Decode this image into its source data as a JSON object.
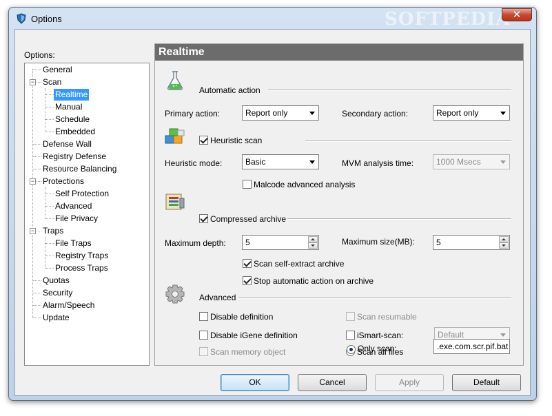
{
  "window": {
    "title": "Options",
    "watermark": "SOFTPEDIA",
    "close_glyph": "✕"
  },
  "tree": {
    "label": "Options:",
    "items": [
      {
        "label": "General"
      },
      {
        "label": "Scan",
        "expander": "−"
      },
      {
        "label": "Realtime",
        "selected": true
      },
      {
        "label": "Manual"
      },
      {
        "label": "Schedule"
      },
      {
        "label": "Embedded"
      },
      {
        "label": "Defense Wall"
      },
      {
        "label": "Registry Defense"
      },
      {
        "label": "Resource Balancing"
      },
      {
        "label": "Protections",
        "expander": "−"
      },
      {
        "label": "Self Protection"
      },
      {
        "label": "Advanced"
      },
      {
        "label": "File Privacy"
      },
      {
        "label": "Traps",
        "expander": "−"
      },
      {
        "label": "File Traps"
      },
      {
        "label": "Registry Traps"
      },
      {
        "label": "Process Traps"
      },
      {
        "label": "Quotas"
      },
      {
        "label": "Security"
      },
      {
        "label": "Alarm/Speech"
      },
      {
        "label": "Update"
      }
    ]
  },
  "panel": {
    "title": "Realtime",
    "automatic_action": {
      "section_label": "Automatic action",
      "icon": "flask-icon",
      "primary_label": "Primary action:",
      "primary_value": "Report only",
      "secondary_label": "Secondary action:",
      "secondary_value": "Report only"
    },
    "heuristic": {
      "icon": "blocks-icon",
      "checkbox_label": "Heuristic scan",
      "checked": true,
      "mode_label": "Heuristic mode:",
      "mode_value": "Basic",
      "mvm_label": "MVM analysis time:",
      "mvm_value": "1000 Msecs",
      "malcode_label": "Malcode advanced analysis",
      "malcode_checked": false
    },
    "compressed": {
      "icon": "archive-icon",
      "checkbox_label": "Compressed archive",
      "checked": true,
      "max_depth_label": "Maximum depth:",
      "max_depth_value": "5",
      "max_size_label": "Maximum size(MB):",
      "max_size_value": "5",
      "self_extract_label": "Scan self-extract archive",
      "self_extract_checked": true,
      "stop_action_label": "Stop automatic action on archive",
      "stop_action_checked": true
    },
    "advanced": {
      "icon": "gear-icon",
      "section_label": "Advanced",
      "disable_definition_label": "Disable definition",
      "disable_igene_label": "Disable iGene definition",
      "scan_memory_label": "Scan memory object",
      "scan_resumable_label": "Scan resumable",
      "ismart_label": "iSmart-scan:",
      "ismart_value": "Default",
      "scan_all_label": "Scan all files",
      "only_scan_label": "Only scan:",
      "only_scan_value": ".exe.com.scr.pif.bat"
    }
  },
  "buttons": {
    "ok": "OK",
    "cancel": "Cancel",
    "apply": "Apply",
    "default": "Default"
  }
}
